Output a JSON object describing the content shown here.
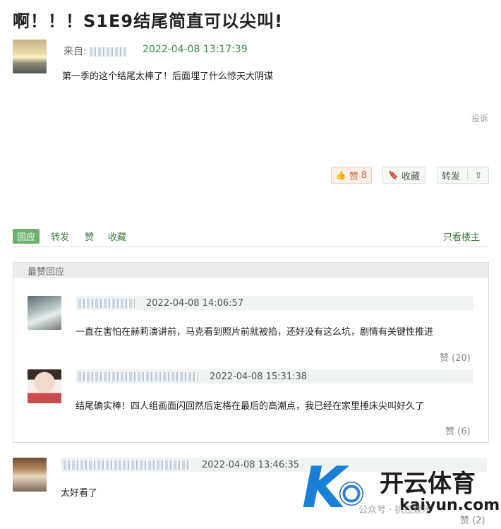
{
  "post": {
    "title": "啊！！！S1E9结尾简直可以尖叫!",
    "from_label": "来自:",
    "time": "2022-04-08 13:17:39",
    "body": "第一季的这个结尾太棒了！后面埋了什么惊天大阴谋",
    "report": "投诉"
  },
  "actions": {
    "like_label": "赞",
    "like_count": "8",
    "collect_label": "收藏",
    "share_label": "转发"
  },
  "tabs": {
    "reply": "回应",
    "share": "转发",
    "like": "赞",
    "collect": "收藏",
    "owner_only": "只看楼主"
  },
  "best": {
    "header": "最赞回应",
    "replies": [
      {
        "time": "2022-04-08 14:06:57",
        "text": "一直在害怕在赫莉演讲前，马克看到照片前就被掐，还好没有这么坑，剧情有关键性推进",
        "likes": "赞 (20)"
      },
      {
        "time": "2022-04-08 15:31:38",
        "text": "结尾确实棒！四人组画面闪回然后定格在最后的高潮点，我已经在家里捶床尖叫好久了",
        "likes": "赞 (6)"
      }
    ]
  },
  "reply3": {
    "time": "2022-04-08 13:46:35",
    "text": "太好看了",
    "likes": "赞 (2)"
  },
  "watermark": {
    "cn": "开云体育",
    "en": "kaiyun.com",
    "foot": "公众号 · 扒拉娱乐"
  }
}
